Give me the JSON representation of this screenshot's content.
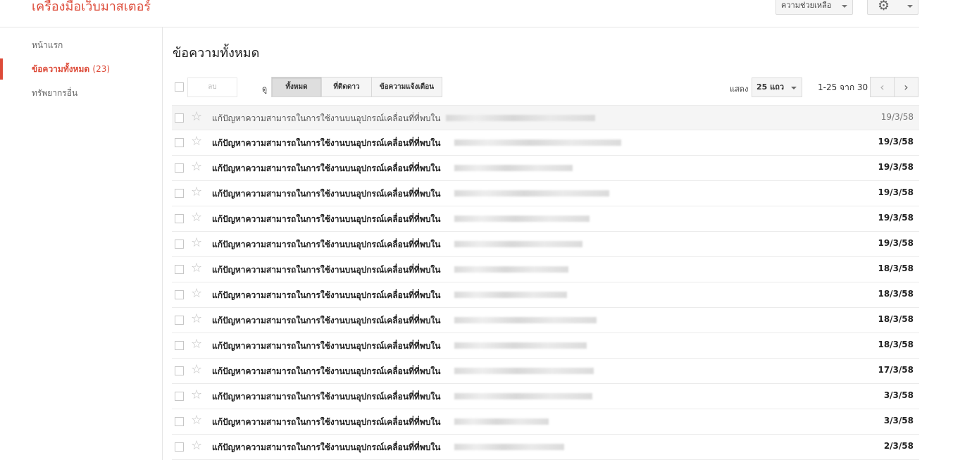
{
  "app": {
    "title": "เครื่องมือเว็บมาสเตอร์"
  },
  "header": {
    "help_label": "ความช่วยเหลือ",
    "settings_icon": "gear-icon"
  },
  "sidebar": {
    "items": [
      {
        "label": "หน้าแรก",
        "count": "",
        "active": false
      },
      {
        "label": "ข้อความทั้งหมด",
        "count": "(23)",
        "active": true
      },
      {
        "label": "ทรัพยากรอื่น",
        "count": "",
        "active": false
      }
    ]
  },
  "main": {
    "title": "ข้อความทั้งหมด",
    "toolbar": {
      "delete_label": "ลบ",
      "view_label": "ดู",
      "filters": [
        {
          "label": "ทั้งหมด",
          "selected": true
        },
        {
          "label": "ที่ติดดาว",
          "selected": false
        },
        {
          "label": "ข้อความแจ้งเตือน",
          "selected": false
        }
      ],
      "show_label": "แสดง",
      "rows_value": "25 แถว",
      "page_range": "1-25 จาก 30"
    },
    "messages": [
      {
        "subject": "แก้ปัญหาความสามารถในการใช้งานบนอุปกรณ์เคลื่อนที่ที่พบใน",
        "date": "19/3/58",
        "read": true
      },
      {
        "subject": "แก้ปัญหาความสามารถในการใช้งานบนอุปกรณ์เคลื่อนที่ที่พบใน",
        "date": "19/3/58",
        "read": false
      },
      {
        "subject": "แก้ปัญหาความสามารถในการใช้งานบนอุปกรณ์เคลื่อนที่ที่พบใน",
        "date": "19/3/58",
        "read": false
      },
      {
        "subject": "แก้ปัญหาความสามารถในการใช้งานบนอุปกรณ์เคลื่อนที่ที่พบใน",
        "date": "19/3/58",
        "read": false
      },
      {
        "subject": "แก้ปัญหาความสามารถในการใช้งานบนอุปกรณ์เคลื่อนที่ที่พบใน",
        "date": "19/3/58",
        "read": false
      },
      {
        "subject": "แก้ปัญหาความสามารถในการใช้งานบนอุปกรณ์เคลื่อนที่ที่พบใน",
        "date": "19/3/58",
        "read": false
      },
      {
        "subject": "แก้ปัญหาความสามารถในการใช้งานบนอุปกรณ์เคลื่อนที่ที่พบใน",
        "date": "18/3/58",
        "read": false
      },
      {
        "subject": "แก้ปัญหาความสามารถในการใช้งานบนอุปกรณ์เคลื่อนที่ที่พบใน",
        "date": "18/3/58",
        "read": false
      },
      {
        "subject": "แก้ปัญหาความสามารถในการใช้งานบนอุปกรณ์เคลื่อนที่ที่พบใน",
        "date": "18/3/58",
        "read": false
      },
      {
        "subject": "แก้ปัญหาความสามารถในการใช้งานบนอุปกรณ์เคลื่อนที่ที่พบใน",
        "date": "18/3/58",
        "read": false
      },
      {
        "subject": "แก้ปัญหาความสามารถในการใช้งานบนอุปกรณ์เคลื่อนที่ที่พบใน",
        "date": "17/3/58",
        "read": false
      },
      {
        "subject": "แก้ปัญหาความสามารถในการใช้งานบนอุปกรณ์เคลื่อนที่ที่พบใน",
        "date": "3/3/58",
        "read": false
      },
      {
        "subject": "แก้ปัญหาความสามารถในการใช้งานบนอุปกรณ์เคลื่อนที่ที่พบใน",
        "date": "3/3/58",
        "read": false
      },
      {
        "subject": "แก้ปัญหาความสามารถในการใช้งานบนอุปกรณ์เคลื่อนที่ที่พบใน",
        "date": "2/3/58",
        "read": false
      }
    ]
  },
  "colors": {
    "accent": "#dd4b39",
    "border": "#e5e5e5",
    "read_row": "#f5f5f5"
  }
}
